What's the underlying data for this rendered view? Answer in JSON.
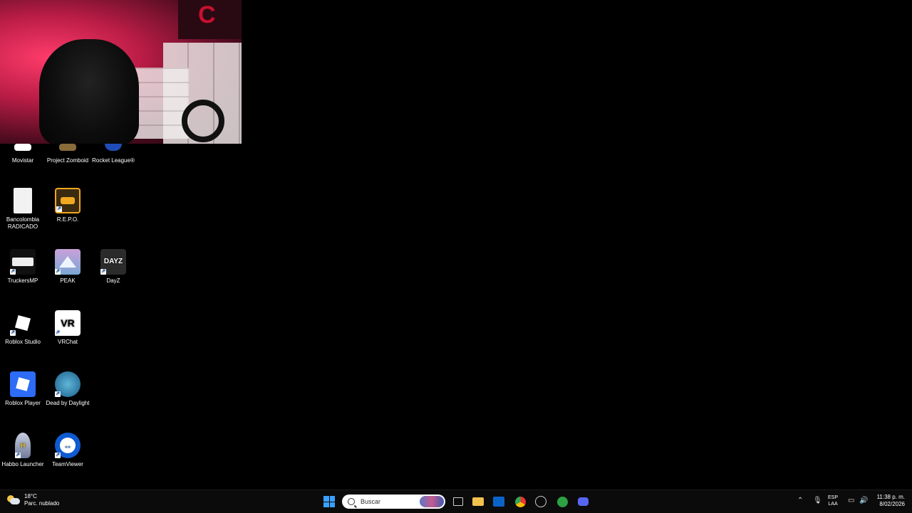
{
  "desktop": {
    "icons": [
      {
        "label": "Movistar",
        "icon": "movistar-icon",
        "color": "#ffffff"
      },
      {
        "label": "Project Zomboid",
        "icon": "project-zomboid-icon",
        "color": "#8a6b3a"
      },
      {
        "label": "Rocket League®",
        "icon": "rocket-league-icon",
        "color": "#1e4db7"
      },
      {
        "label": "Bancolombia RADICADO",
        "icon": "file-icon",
        "color": "#f2f2f2"
      },
      {
        "label": "R.E.P.O.",
        "icon": "repo-game-icon",
        "color": "#3a2a10"
      },
      {
        "label": "TruckersMP",
        "icon": "truckersmp-icon",
        "color": "#101010"
      },
      {
        "label": "PEAK",
        "icon": "peak-game-icon",
        "color": "#7aa7d6"
      },
      {
        "label": "DayZ",
        "icon": "dayz-icon",
        "color": "#2b2b2b"
      },
      {
        "label": "Roblox Studio",
        "icon": "roblox-studio-icon",
        "color": "#000000"
      },
      {
        "label": "VRChat",
        "icon": "vrchat-icon",
        "color": "#ffffff"
      },
      {
        "label": "Roblox Player",
        "icon": "roblox-player-icon",
        "color": "#2d6cf6"
      },
      {
        "label": "Dead by Daylight",
        "icon": "dead-by-daylight-icon",
        "color": "#1b5d8a"
      },
      {
        "label": "Habbo Launcher",
        "icon": "habbo-launcher-icon",
        "color": "#9aa5c0"
      },
      {
        "label": "TeamViewer",
        "icon": "teamviewer-icon",
        "color": "#0e5bd1"
      }
    ],
    "vrchat_glyph": "VR",
    "dayz_glyph": "DAYZ"
  },
  "taskbar": {
    "weather": {
      "temp": "18°C",
      "condition": "Parc. nublado"
    },
    "search": {
      "placeholder": "Buscar"
    },
    "apps": [
      "task-view-icon",
      "file-explorer-icon",
      "outlook-icon",
      "chrome-icon",
      "steam-icon",
      "xbox-icon",
      "discord-icon"
    ],
    "lang": {
      "line1": "ESP",
      "line2": "LAA"
    },
    "clock": {
      "time": "11:38 p. m.",
      "date": "8/02/2026"
    }
  },
  "webcam": {
    "sign_glyph": "C"
  }
}
